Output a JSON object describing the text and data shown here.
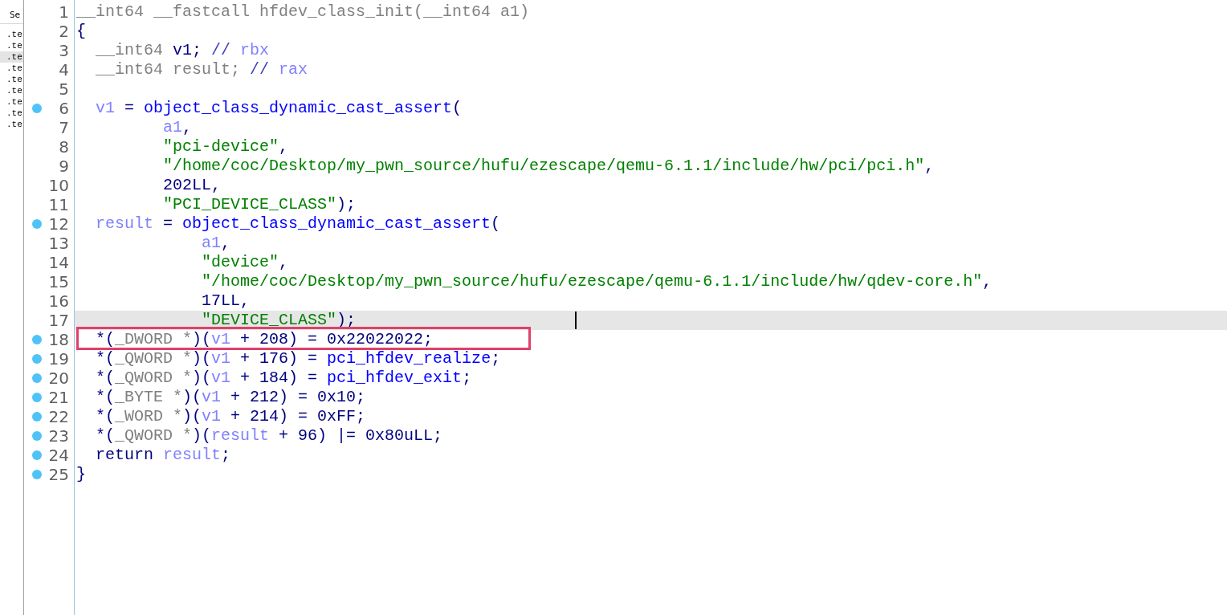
{
  "side_panel": {
    "header": "Se",
    "items": [
      {
        "label": ".te",
        "selected": false
      },
      {
        "label": ".te",
        "selected": false
      },
      {
        "label": ".te",
        "selected": true
      },
      {
        "label": ".te",
        "selected": false
      },
      {
        "label": ".te",
        "selected": false
      },
      {
        "label": ".te",
        "selected": false
      },
      {
        "label": ".te",
        "selected": false
      },
      {
        "label": ".te",
        "selected": false
      },
      {
        "label": ".te",
        "selected": false
      }
    ]
  },
  "code_lines": [
    {
      "number": "1",
      "breakpoint": false,
      "current": false,
      "boxed": false,
      "tokens": [
        {
          "kind": "type",
          "text": "__int64 __fastcall hfdev_class_init(__int64 a1)"
        }
      ]
    },
    {
      "number": "2",
      "breakpoint": false,
      "current": false,
      "boxed": false,
      "tokens": [
        {
          "kind": "plain",
          "text": "{"
        }
      ]
    },
    {
      "number": "3",
      "breakpoint": false,
      "current": false,
      "boxed": false,
      "tokens": [
        {
          "kind": "type",
          "text": "  __int64 "
        },
        {
          "kind": "plain",
          "text": "v1; "
        },
        {
          "kind": "comment",
          "text": "// "
        },
        {
          "kind": "var",
          "text": "rbx"
        }
      ]
    },
    {
      "number": "4",
      "breakpoint": false,
      "current": false,
      "boxed": false,
      "tokens": [
        {
          "kind": "type",
          "text": "  __int64 result; "
        },
        {
          "kind": "comment",
          "text": "// "
        },
        {
          "kind": "var",
          "text": "rax"
        }
      ]
    },
    {
      "number": "5",
      "breakpoint": false,
      "current": false,
      "boxed": false
    },
    {
      "number": "6",
      "breakpoint": true,
      "current": false,
      "boxed": false,
      "tokens": [
        {
          "kind": "var",
          "text": "  v1"
        },
        {
          "kind": "plain",
          "text": " = "
        },
        {
          "kind": "func",
          "text": "object_class_dynamic_cast_assert"
        },
        {
          "kind": "plain",
          "text": "("
        }
      ]
    },
    {
      "number": "7",
      "breakpoint": false,
      "current": false,
      "boxed": false,
      "tokens": [
        {
          "kind": "var",
          "text": "         a1"
        },
        {
          "kind": "plain",
          "text": ","
        }
      ]
    },
    {
      "number": "8",
      "breakpoint": false,
      "current": false,
      "boxed": false,
      "tokens": [
        {
          "kind": "string",
          "text": "         \"pci-device\""
        },
        {
          "kind": "plain",
          "text": ","
        }
      ]
    },
    {
      "number": "9",
      "breakpoint": false,
      "current": false,
      "boxed": false,
      "tokens": [
        {
          "kind": "string",
          "text": "         \"/home/coc/Desktop/my_pwn_source/hufu/ezescape/qemu-6.1.1/include/hw/pci/pci.h\""
        },
        {
          "kind": "plain",
          "text": ","
        }
      ]
    },
    {
      "number": "10",
      "breakpoint": false,
      "current": false,
      "boxed": false,
      "tokens": [
        {
          "kind": "plain",
          "text": "         202LL,"
        }
      ]
    },
    {
      "number": "11",
      "breakpoint": false,
      "current": false,
      "boxed": false,
      "tokens": [
        {
          "kind": "string",
          "text": "         \"PCI_DEVICE_CLASS\""
        },
        {
          "kind": "plain",
          "text": ");"
        }
      ]
    },
    {
      "number": "12",
      "breakpoint": true,
      "current": false,
      "boxed": false,
      "tokens": [
        {
          "kind": "var",
          "text": "  result"
        },
        {
          "kind": "plain",
          "text": " = "
        },
        {
          "kind": "func",
          "text": "object_class_dynamic_cast_assert"
        },
        {
          "kind": "plain",
          "text": "("
        }
      ]
    },
    {
      "number": "13",
      "breakpoint": false,
      "current": false,
      "boxed": false,
      "tokens": [
        {
          "kind": "var",
          "text": "             a1"
        },
        {
          "kind": "plain",
          "text": ","
        }
      ]
    },
    {
      "number": "14",
      "breakpoint": false,
      "current": false,
      "boxed": false,
      "tokens": [
        {
          "kind": "string",
          "text": "             \"device\""
        },
        {
          "kind": "plain",
          "text": ","
        }
      ]
    },
    {
      "number": "15",
      "breakpoint": false,
      "current": false,
      "boxed": false,
      "tokens": [
        {
          "kind": "string",
          "text": "             \"/home/coc/Desktop/my_pwn_source/hufu/ezescape/qemu-6.1.1/include/hw/qdev-core.h\""
        },
        {
          "kind": "plain",
          "text": ","
        }
      ]
    },
    {
      "number": "16",
      "breakpoint": false,
      "current": false,
      "boxed": false,
      "tokens": [
        {
          "kind": "plain",
          "text": "             17LL,"
        }
      ]
    },
    {
      "number": "17",
      "breakpoint": false,
      "current": true,
      "boxed": false,
      "tokens": [
        {
          "kind": "string",
          "text": "             \"DEVICE_CLASS\""
        },
        {
          "kind": "plain",
          "text": ");"
        }
      ]
    },
    {
      "number": "18",
      "breakpoint": true,
      "current": false,
      "boxed": true,
      "tokens": [
        {
          "kind": "plain",
          "text": "  *("
        },
        {
          "kind": "type",
          "text": "_DWORD *"
        },
        {
          "kind": "plain",
          "text": ")("
        },
        {
          "kind": "var",
          "text": "v1"
        },
        {
          "kind": "plain",
          "text": " + 208) = 0x22022022;"
        }
      ]
    },
    {
      "number": "19",
      "breakpoint": true,
      "current": false,
      "boxed": false,
      "tokens": [
        {
          "kind": "plain",
          "text": "  *("
        },
        {
          "kind": "type",
          "text": "_QWORD *"
        },
        {
          "kind": "plain",
          "text": ")("
        },
        {
          "kind": "var",
          "text": "v1"
        },
        {
          "kind": "plain",
          "text": " + 176) = "
        },
        {
          "kind": "func",
          "text": "pci_hfdev_realize"
        },
        {
          "kind": "plain",
          "text": ";"
        }
      ]
    },
    {
      "number": "20",
      "breakpoint": true,
      "current": false,
      "boxed": false,
      "tokens": [
        {
          "kind": "plain",
          "text": "  *("
        },
        {
          "kind": "type",
          "text": "_QWORD *"
        },
        {
          "kind": "plain",
          "text": ")("
        },
        {
          "kind": "var",
          "text": "v1"
        },
        {
          "kind": "plain",
          "text": " + 184) = "
        },
        {
          "kind": "func",
          "text": "pci_hfdev_exit"
        },
        {
          "kind": "plain",
          "text": ";"
        }
      ]
    },
    {
      "number": "21",
      "breakpoint": true,
      "current": false,
      "boxed": false,
      "tokens": [
        {
          "kind": "plain",
          "text": "  *("
        },
        {
          "kind": "type",
          "text": "_BYTE *"
        },
        {
          "kind": "plain",
          "text": ")("
        },
        {
          "kind": "var",
          "text": "v1"
        },
        {
          "kind": "plain",
          "text": " + 212) = 0x10;"
        }
      ]
    },
    {
      "number": "22",
      "breakpoint": true,
      "current": false,
      "boxed": false,
      "tokens": [
        {
          "kind": "plain",
          "text": "  *("
        },
        {
          "kind": "type",
          "text": "_WORD *"
        },
        {
          "kind": "plain",
          "text": ")("
        },
        {
          "kind": "var",
          "text": "v1"
        },
        {
          "kind": "plain",
          "text": " + 214) = 0xFF;"
        }
      ]
    },
    {
      "number": "23",
      "breakpoint": true,
      "current": false,
      "boxed": false,
      "tokens": [
        {
          "kind": "plain",
          "text": "  *("
        },
        {
          "kind": "type",
          "text": "_QWORD *"
        },
        {
          "kind": "plain",
          "text": ")("
        },
        {
          "kind": "var",
          "text": "result"
        },
        {
          "kind": "plain",
          "text": " + 96) |= 0x80uLL;"
        }
      ]
    },
    {
      "number": "24",
      "breakpoint": true,
      "current": false,
      "boxed": false,
      "tokens": [
        {
          "kind": "plain",
          "text": "  return "
        },
        {
          "kind": "var",
          "text": "result"
        },
        {
          "kind": "plain",
          "text": ";"
        }
      ]
    },
    {
      "number": "25",
      "breakpoint": true,
      "current": false,
      "boxed": false,
      "tokens": [
        {
          "kind": "plain",
          "text": "}"
        }
      ]
    }
  ]
}
